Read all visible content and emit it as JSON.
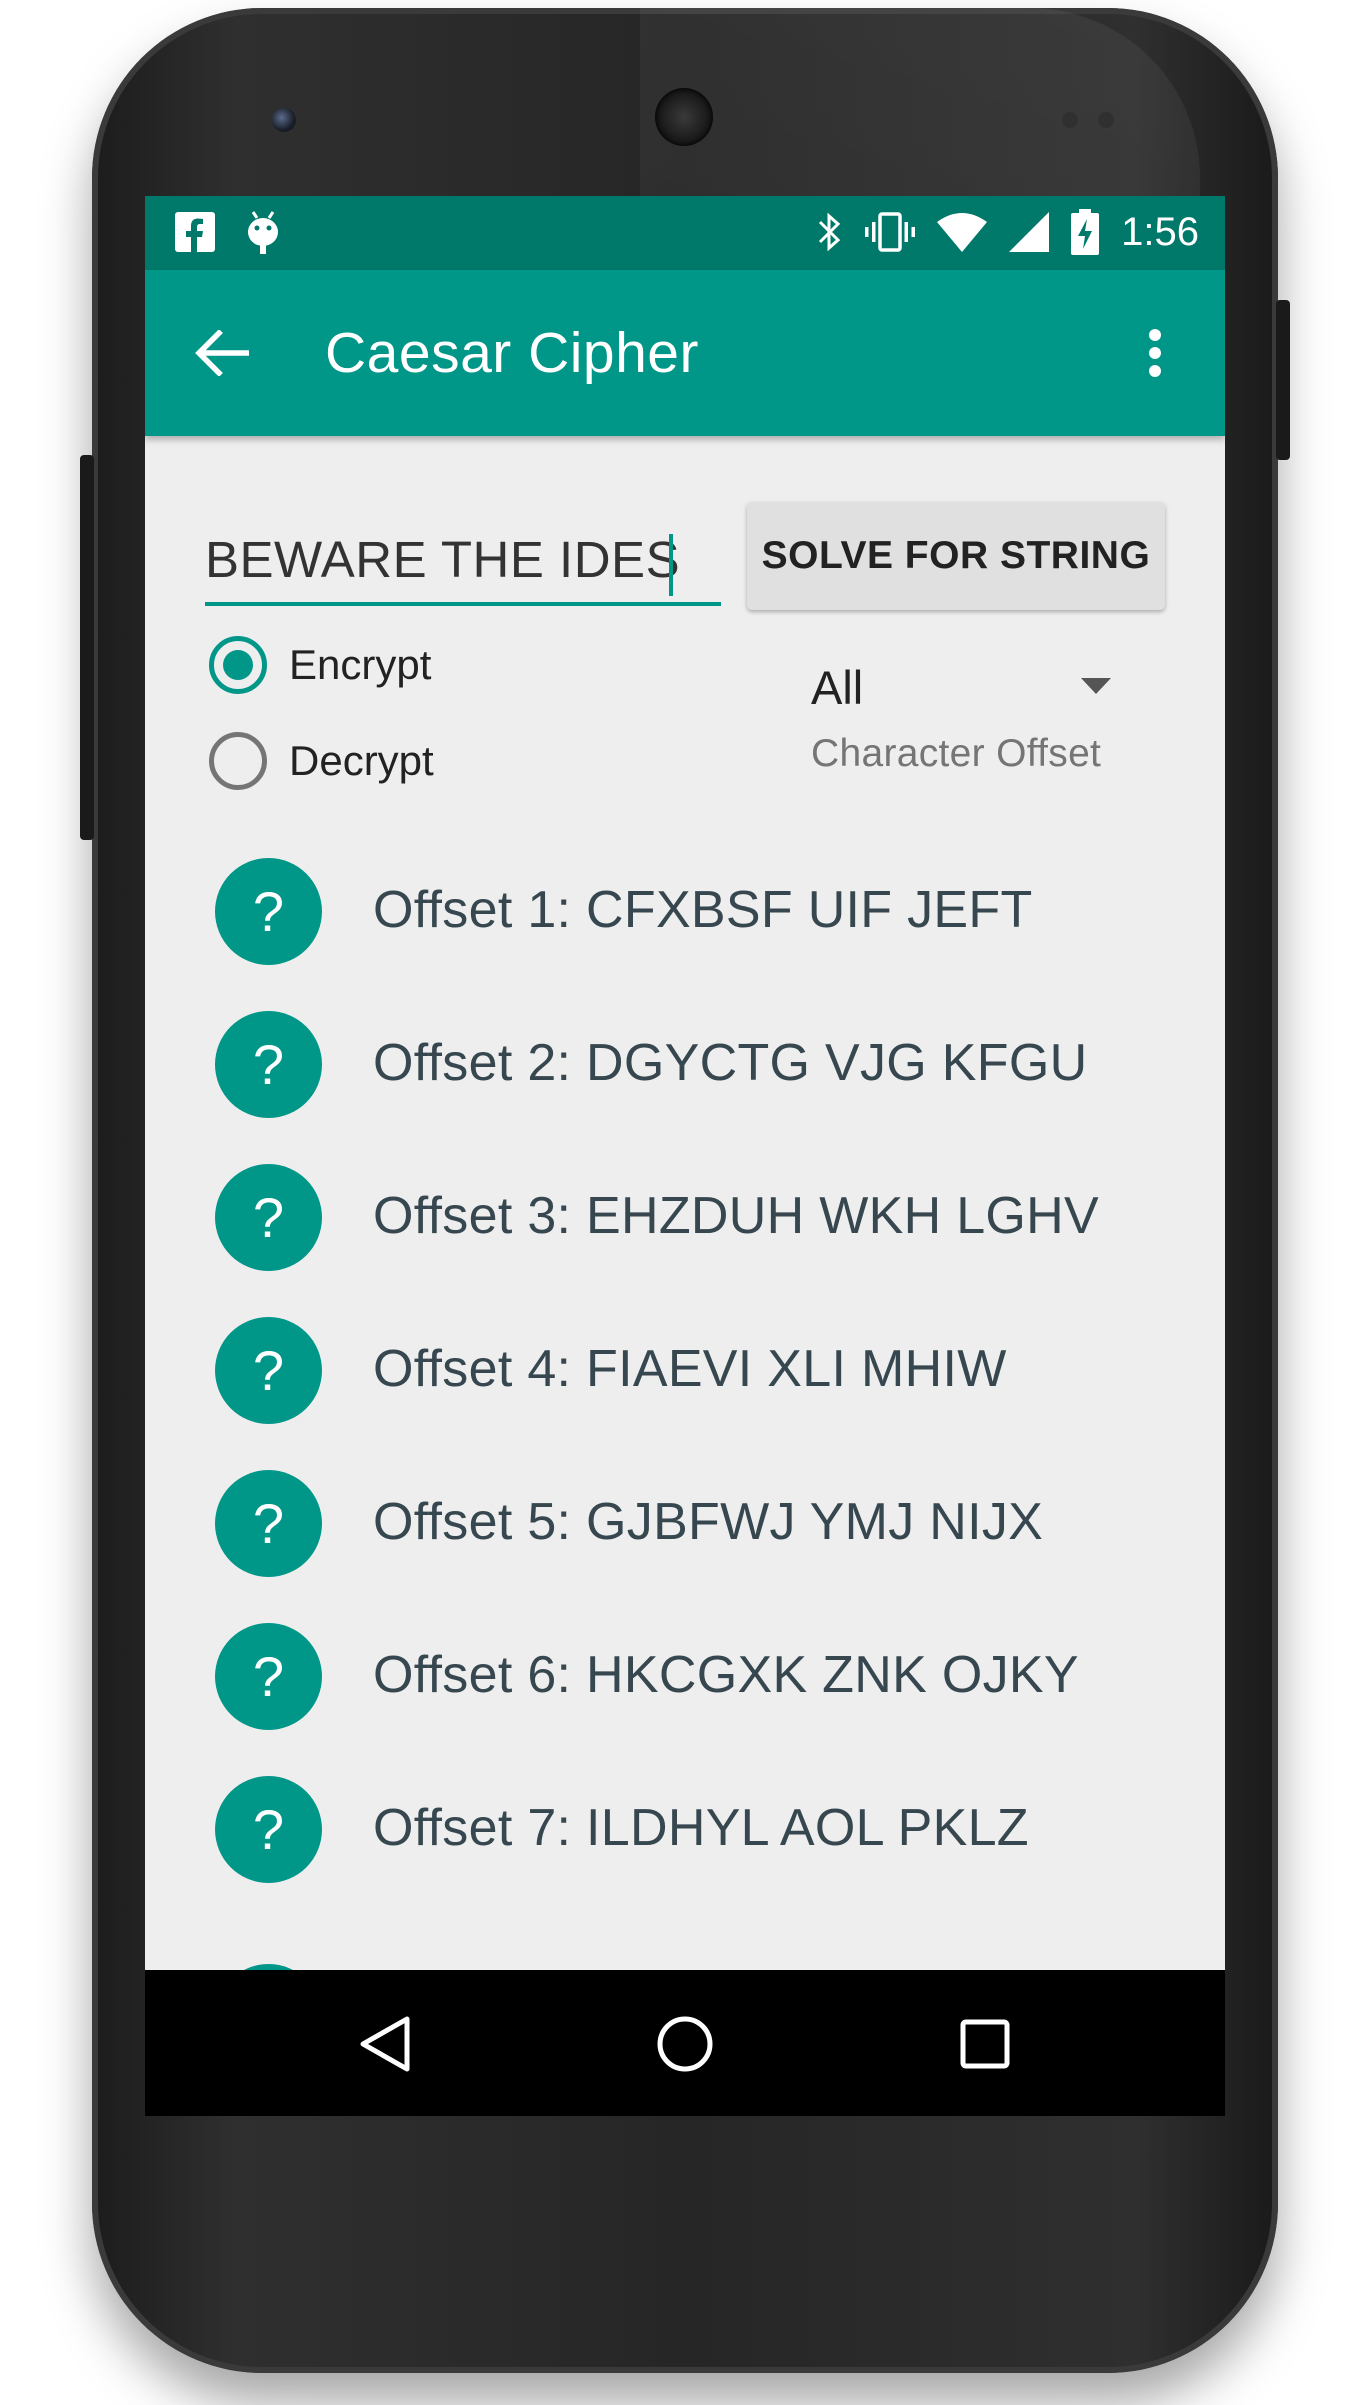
{
  "status_bar": {
    "time": "1:56",
    "icons": [
      "facebook-icon",
      "android-debug-icon",
      "bluetooth-icon",
      "vibrate-icon",
      "wifi-icon",
      "cell-signal-icon",
      "battery-charging-icon"
    ]
  },
  "app_bar": {
    "title": "Caesar Cipher",
    "back_icon": "arrow-back-icon",
    "menu_icon": "more-vert-icon"
  },
  "input": {
    "value": "BEWARE THE IDES"
  },
  "solve_button": {
    "label": "SOLVE FOR STRING"
  },
  "mode": {
    "options": [
      {
        "label": "Encrypt",
        "checked": true
      },
      {
        "label": "Decrypt",
        "checked": false
      }
    ]
  },
  "offset_spinner": {
    "value": "All",
    "caption": "Character Offset"
  },
  "results": [
    {
      "icon_label": "?",
      "text": "Offset 1: CFXBSF UIF JEFT"
    },
    {
      "icon_label": "?",
      "text": "Offset 2: DGYCTG VJG KFGU"
    },
    {
      "icon_label": "?",
      "text": "Offset 3: EHZDUH WKH LGHV"
    },
    {
      "icon_label": "?",
      "text": "Offset 4: FIAEVI XLI MHIW"
    },
    {
      "icon_label": "?",
      "text": "Offset 5: GJBFWJ YMJ NIJX"
    },
    {
      "icon_label": "?",
      "text": "Offset 6: HKCGXK ZNK OJKY"
    },
    {
      "icon_label": "?",
      "text": "Offset 7: ILDHYL AOL PKLZ"
    }
  ],
  "colors": {
    "primary": "#009688",
    "primary_dark": "#00796b",
    "background": "#eeeeee"
  }
}
